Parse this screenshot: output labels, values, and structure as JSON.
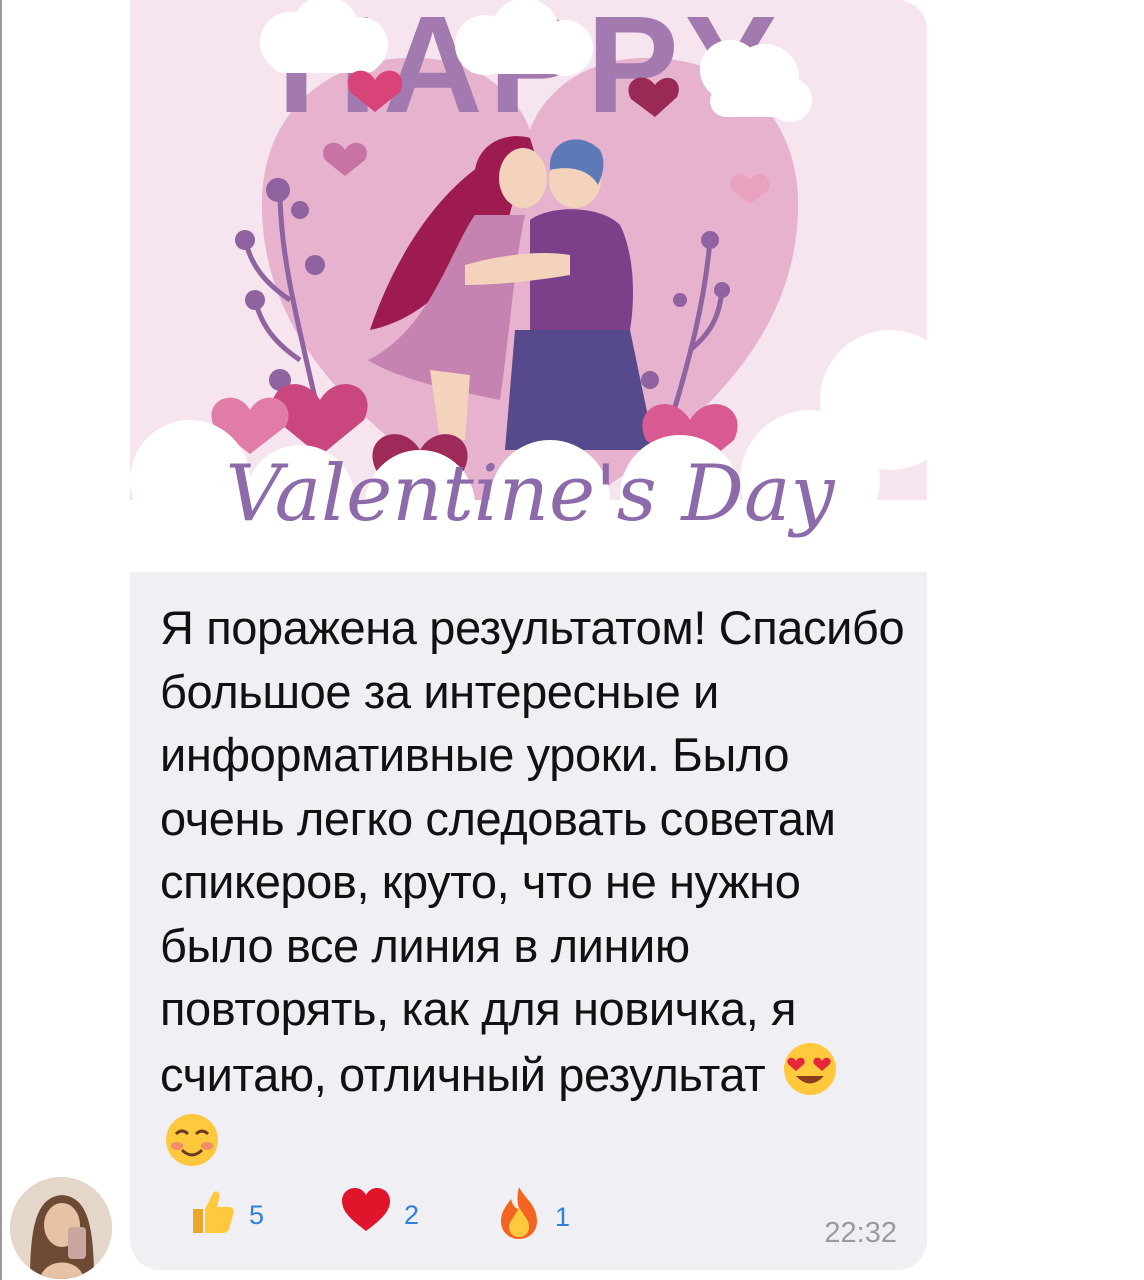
{
  "image": {
    "alt": "Valentine's Day card",
    "headline": "HAPPY",
    "script_text": "Valentine's Day"
  },
  "message": {
    "text": "Я поражена результатом! Спасибо большое за интересные и информативные уроки. Было очень легко следовать советам спикеров, круто, что не нужно было все линия в линию повторять, как для новичка, я считаю, отличный результат",
    "emojis": [
      "heart-eyes-emoji",
      "smiling-blush-emoji"
    ]
  },
  "reactions": [
    {
      "icon": "thumbs-up-icon",
      "count": "5"
    },
    {
      "icon": "heart-icon",
      "count": "2"
    },
    {
      "icon": "fire-icon",
      "count": "1"
    }
  ],
  "time": "22:32",
  "colors": {
    "bubble": "#efeff4",
    "reaction_count": "#2f7fe0",
    "time": "#9a9aa0",
    "card_bg": "#f6e4ee",
    "heart_pink": "#e8a8c8",
    "title_purple": "#a27ab0"
  }
}
